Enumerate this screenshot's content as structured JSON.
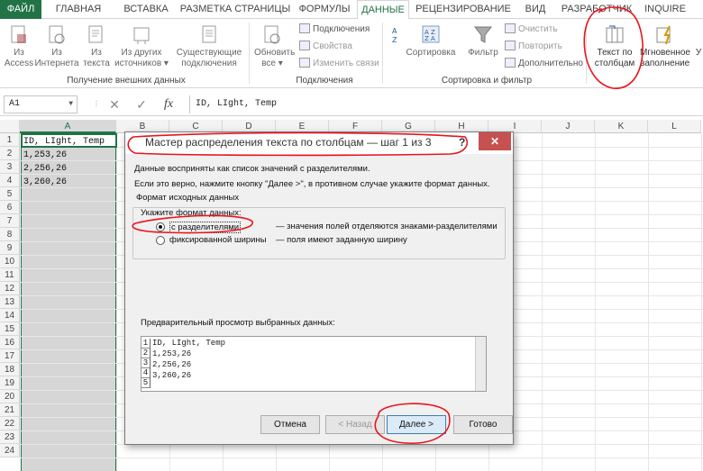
{
  "tabs": [
    "ФАЙЛ",
    "ГЛАВНАЯ",
    "ВСТАВКА",
    "РАЗМЕТКА СТРАНИЦЫ",
    "ФОРМУЛЫ",
    "ДАННЫЕ",
    "РЕЦЕНЗИРОВАНИЕ",
    "ВИД",
    "РАЗРАБОТЧИК",
    "INQUIRE"
  ],
  "ribbon": {
    "external": {
      "access": [
        "Из",
        "Access"
      ],
      "internet": [
        "Из",
        "Интернета"
      ],
      "text": [
        "Из",
        "текста"
      ],
      "other": [
        "Из других",
        "источников ▾"
      ],
      "existing": [
        "Существующие",
        "подключения"
      ],
      "label": "Получение внешних данных"
    },
    "connections": {
      "refresh": [
        "Обновить",
        "все ▾"
      ],
      "items": [
        "Подключения",
        "Свойства",
        "Изменить связи"
      ],
      "label": "Подключения"
    },
    "sort": {
      "sort": "Сортировка",
      "filter": "Фильтр",
      "items": [
        "Очистить",
        "Повторить",
        "Дополнительно"
      ],
      "label": "Сортировка и фильтр"
    },
    "tools": {
      "text_to_cols": [
        "Текст по",
        "столбцам"
      ],
      "flash_fill": [
        "Мгновенное",
        "заполнение"
      ],
      "cut_letter": "У"
    }
  },
  "formula_bar": {
    "name_box": "A1",
    "cancel": "✕",
    "enter": "✓",
    "fx": "fx",
    "formula": "ID, LIght, Temp"
  },
  "sheet": {
    "columns": [
      "A",
      "B",
      "C",
      "D",
      "E",
      "F",
      "G",
      "H",
      "I",
      "J",
      "K",
      "L"
    ],
    "rows": [
      "1",
      "2",
      "3",
      "4",
      "5",
      "6",
      "7",
      "8",
      "9",
      "10",
      "11",
      "12",
      "13",
      "14",
      "15",
      "16",
      "17",
      "18",
      "19",
      "20",
      "21",
      "22",
      "23",
      "24"
    ],
    "cells": [
      "ID, LIght, Temp",
      "1,253,26",
      "2,256,26",
      "3,260,26"
    ]
  },
  "dialog": {
    "title": "Мастер распределения текста по столбцам — шаг 1 из 3",
    "help": "?",
    "close": "✕",
    "line1": "Данные восприняты как список значений с разделителями.",
    "line2": "Если это верно, нажмите кнопку \"Далее >\", в противном случае укажите формат данных.",
    "group_title": "Формат исходных данных",
    "group_prompt": "Укажите формат данных:",
    "opt_delimited": "с разделителями",
    "opt_delimited_desc": "— значения полей отделяются знаками-разделителями",
    "opt_fixed": "фиксированной ширины",
    "opt_fixed_desc": "— поля имеют заданную ширину",
    "preview_label": "Предварительный просмотр выбранных данных:",
    "preview_nums": [
      "1",
      "2",
      "3",
      "4",
      "5"
    ],
    "preview_lines": [
      "ID, LIght, Temp",
      "1,253,26",
      "2,256,26",
      "3,260,26"
    ],
    "buttons": {
      "cancel": "Отмена",
      "back": "< Назад",
      "next": "Далее >",
      "finish": "Готово"
    }
  },
  "colors": {
    "excel_green": "#217346",
    "annotation_red": "#e8141b",
    "close_red": "#c75050"
  }
}
